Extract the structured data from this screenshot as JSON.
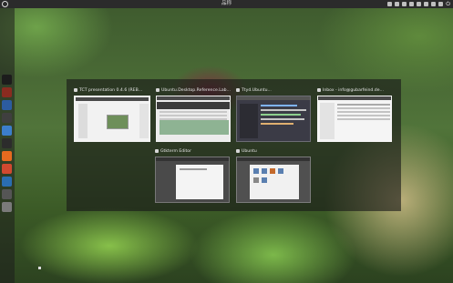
{
  "top_panel": {
    "title": "品称",
    "tray_icons": [
      "network-icon",
      "keyboard-icon",
      "chat-icon",
      "mail-icon",
      "volume-icon",
      "battery-icon",
      "clock-icon",
      "user-icon",
      "power-icon"
    ]
  },
  "launcher": {
    "items": [
      {
        "name": "ubuntu-logo-icon",
        "color": "#1c1c1c"
      },
      {
        "name": "files-icon",
        "color": "#8a2b20"
      },
      {
        "name": "browser-icon",
        "color": "#2c5ca0"
      },
      {
        "name": "settings-icon",
        "color": "#3f3f3f"
      },
      {
        "name": "text-editor-icon",
        "color": "#3c7ecb"
      },
      {
        "name": "terminal-icon",
        "color": "#2c2c2c"
      },
      {
        "name": "firefox-icon",
        "color": "#e66a1f"
      },
      {
        "name": "store-icon",
        "color": "#d14930"
      },
      {
        "name": "app-icon",
        "color": "#2a6db0"
      },
      {
        "name": "workspace-icon",
        "color": "#555555"
      },
      {
        "name": "trash-icon",
        "color": "#7a7a7a"
      }
    ]
  },
  "spread": {
    "windows": [
      {
        "label": "TCT presentation 0.4.6 (REB...",
        "active": true
      },
      {
        "label": "Ubuntu.Desktop.Reference.Lab...",
        "active": false
      },
      {
        "label": "Ttyd.Ubuntu...",
        "active": false
      },
      {
        "label": "Inbox - info@gubarfeind.de...",
        "active": false
      },
      {
        "label": "Gtkterm Editor",
        "active": false
      },
      {
        "label": "Ubuntu",
        "active": false
      }
    ]
  }
}
